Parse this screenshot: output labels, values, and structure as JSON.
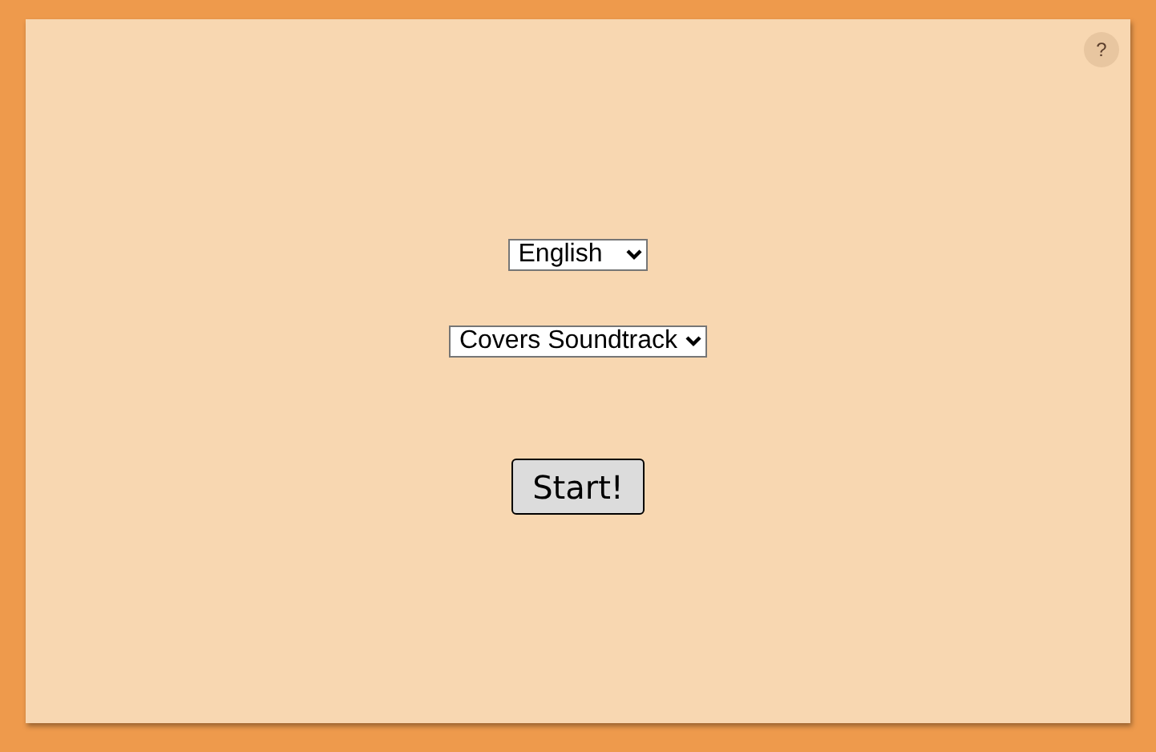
{
  "help_button": {
    "label": "?"
  },
  "language_select": {
    "value": "English"
  },
  "soundtrack_select": {
    "value": "Covers Soundtrack"
  },
  "start_button": {
    "label": "Start!"
  }
}
